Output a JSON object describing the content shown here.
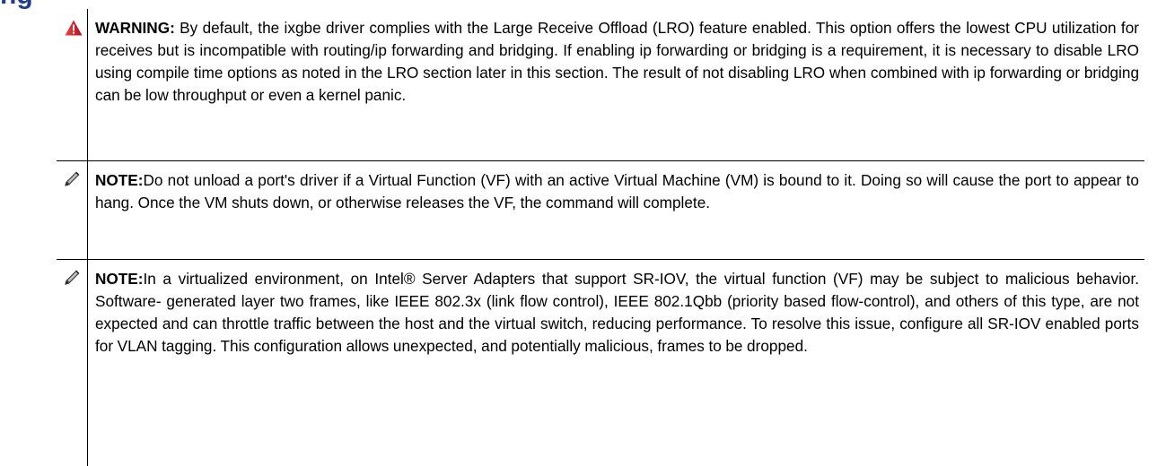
{
  "heading_fragment": "ng",
  "notes": [
    {
      "type": "warning",
      "icon": "warning-triangle-icon",
      "label": "WARNING:",
      "text": " By default, the ixgbe driver complies with the Large Receive Offload (LRO) feature enabled. This option offers the lowest CPU utilization for receives but is incompatible with routing/ip forwarding and bridging. If enabling ip forwarding or bridging is a requirement, it is necessary to disable LRO using compile time options as noted in the LRO section later in this section. The result of not disabling LRO when combined with ip for­warding or bridging can be low throughput or even a kernel panic."
    },
    {
      "type": "note",
      "icon": "pencil-icon",
      "label": "NOTE:",
      "text": "Do not unload a port's driver if a Virtual Function (VF) with an active Virtual Machine (VM) is bound to it. Doing so will cause the port to appear to hang. Once the VM shuts down, or otherwise releases the VF, the com­mand will complete."
    },
    {
      "type": "note",
      "icon": "pencil-icon",
      "label": "NOTE:",
      "text": "In a virtualized environment, on Intel® Server Adapters that support SR-IOV, the virtual function (VF) may be subject to malicious behavior. Software- generated layer two frames, like IEEE 802.3x (link flow control), IEEE 802.1Qbb (priority based flow-control), and others of this type, are not expected and can throttle traffic between the host and the virtual switch, reducing performance. To resolve this issue, configure all SR-IOV enabled ports for VLAN tagging. This configuration allows unexpected, and potentially malicious, frames to be dropped."
    }
  ],
  "colors": {
    "heading": "#1f3e8c",
    "warning_icon": "#d6252d",
    "rule": "#000000"
  }
}
